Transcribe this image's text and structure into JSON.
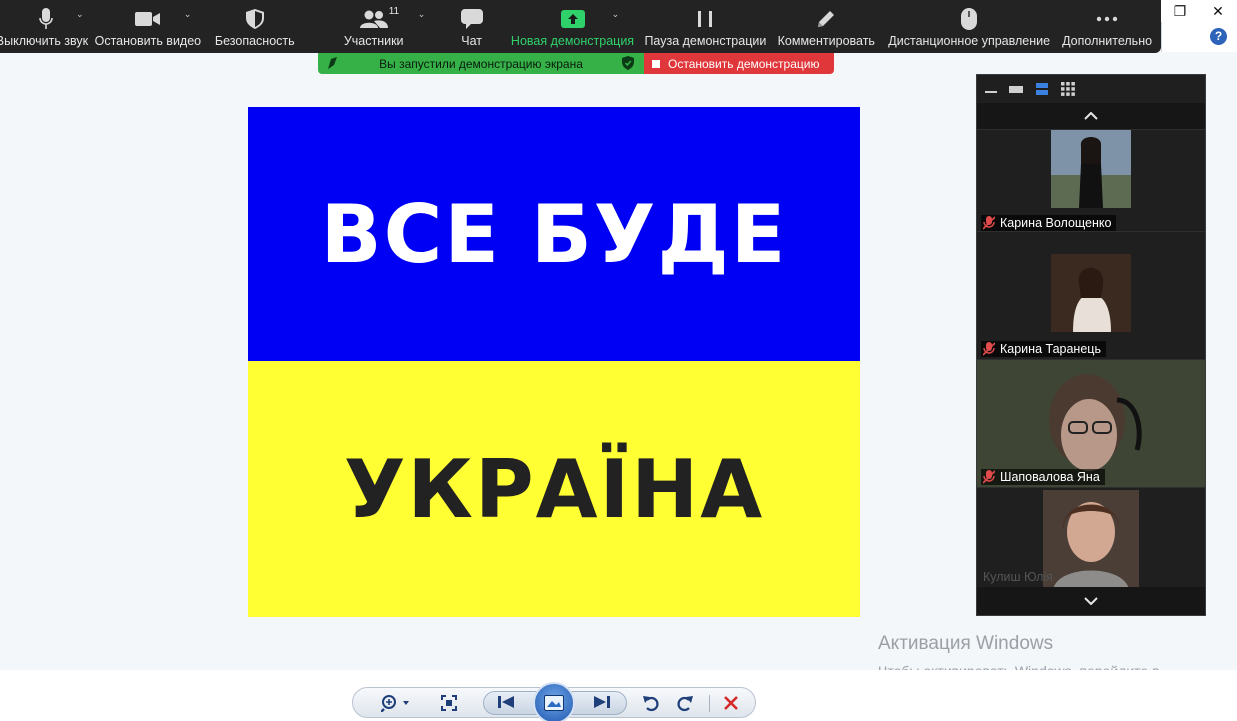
{
  "toolbar": {
    "mute_label": "Выключить звук",
    "video_label": "Остановить видео",
    "security_label": "Безопасность",
    "participants_label": "Участники",
    "participants_count": "11",
    "chat_label": "Чат",
    "new_share_label": "Новая демонстрация",
    "pause_share_label": "Пауза демонстрации",
    "annotate_label": "Комментировать",
    "remote_control_label": "Дистанционное управление",
    "more_label": "Дополнительно"
  },
  "share_banner": {
    "status_text": "Вы запустили демонстрацию экрана",
    "stop_label": "Остановить демонстрацию"
  },
  "shared_content": {
    "top_text": "ВСЕ БУДЕ",
    "bottom_text": "УКРАЇНА"
  },
  "gallery": {
    "participants": [
      {
        "name": "Карина Волощенко"
      },
      {
        "name": "Карина Таранець"
      },
      {
        "name": "Шаповалова Яна"
      },
      {
        "name": "Кулиш Юлія"
      }
    ]
  },
  "watermark": {
    "title": "Активация Windows",
    "line": "Чтобы активировать Windows, перейдите в раздел \"Параметры\"."
  },
  "colors": {
    "flag_blue": "#0000f5",
    "flag_yellow": "#ffff33",
    "share_green": "#35b148",
    "stop_red": "#e0373b"
  }
}
